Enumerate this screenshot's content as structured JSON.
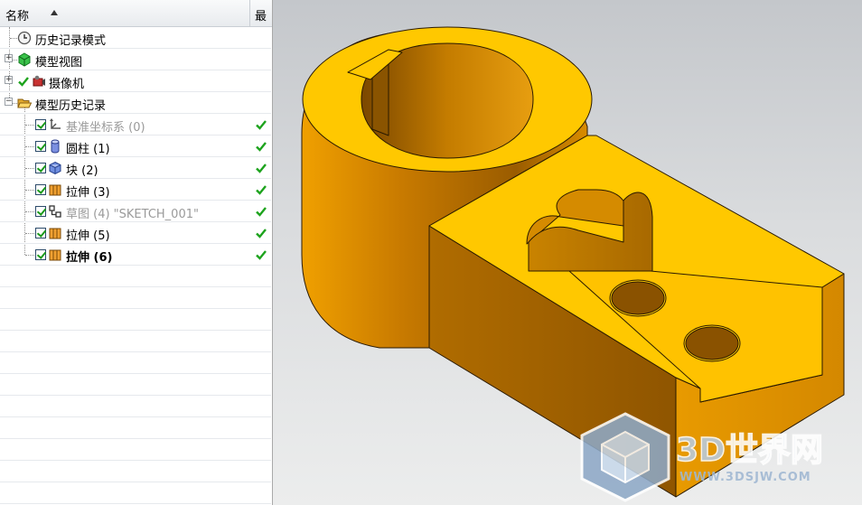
{
  "navigator": {
    "columns": {
      "name": "名称",
      "latest": "最"
    },
    "nodes": [
      {
        "label": "历史记录模式",
        "icon": "clock-icon"
      },
      {
        "label": "模型视图",
        "icon": "model-views-icon"
      },
      {
        "label": "摄像机",
        "icon": "camera-icon"
      },
      {
        "label": "模型历史记录",
        "icon": "folder-open-icon"
      }
    ],
    "features": [
      {
        "label": "基准坐标系 (0)",
        "icon": "datum-csys-icon",
        "dim": true
      },
      {
        "label": "圆柱 (1)",
        "icon": "cylinder-icon",
        "dim": false
      },
      {
        "label": "块 (2)",
        "icon": "block-icon",
        "dim": false
      },
      {
        "label": "拉伸 (3)",
        "icon": "extrude-icon",
        "dim": false
      },
      {
        "label": "草图 (4) \"SKETCH_001\"",
        "icon": "sketch-icon",
        "dim": true
      },
      {
        "label": "拉伸 (5)",
        "icon": "extrude-icon",
        "dim": false
      },
      {
        "label": "拉伸 (6)",
        "icon": "extrude-icon",
        "dim": false,
        "current": true
      }
    ]
  },
  "graphics": {
    "part_color": "#ffc800",
    "side_color": "#e89800",
    "background_top": "#c4c7cb",
    "background_bottom": "#eceded"
  },
  "watermark": {
    "brand": "3D世界网",
    "url": "WWW.3DSJW.COM"
  }
}
